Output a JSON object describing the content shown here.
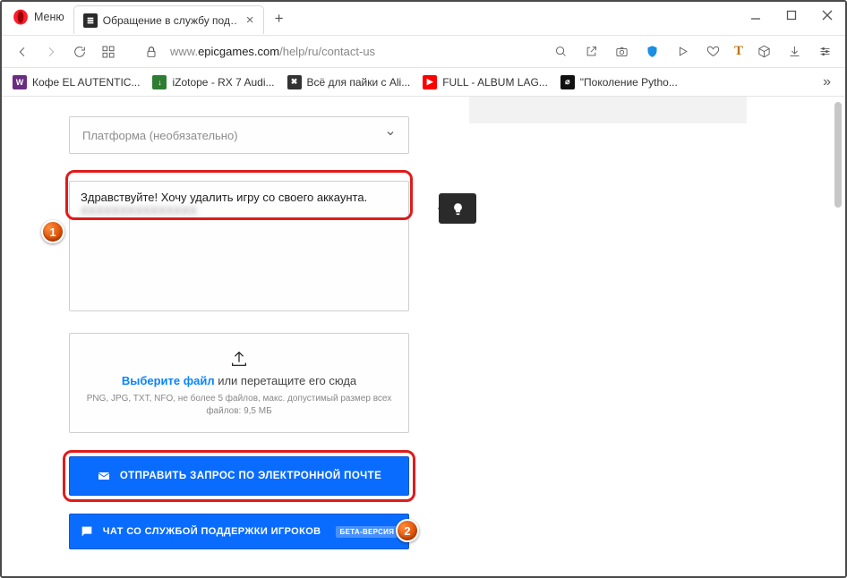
{
  "window": {
    "menu_label": "Меню",
    "tab_title": "Обращение в службу под…"
  },
  "address": {
    "url_prefix": "www.",
    "url_host": "epicgames.com",
    "url_path": "/help/ru/contact-us"
  },
  "bookmarks": [
    {
      "label": "Кофе EL AUTENTIC...",
      "bg": "#6a2d82",
      "glyph": "W"
    },
    {
      "label": "iZotope - RX 7 Audi...",
      "bg": "#2e7d32",
      "glyph": "↓"
    },
    {
      "label": "Всё для пайки с Ali...",
      "bg": "#333",
      "glyph": "✖"
    },
    {
      "label": "FULL - ALBUM LAG...",
      "bg": "#ff0000",
      "glyph": "▶"
    },
    {
      "label": "\"Поколение Pytho...",
      "bg": "#111",
      "glyph": "⌀"
    }
  ],
  "form": {
    "platform_placeholder": "Платформа (необязательно)",
    "textarea_value": "Здравствуйте! Хочу удалить игру со своего аккаунта.",
    "upload_link": "Выберите файл",
    "upload_rest": " или перетащите его сюда",
    "upload_hint": "PNG, JPG, TXT, NFO, не более 5 файлов, макс. допустимый размер всех файлов: 9,5 МБ",
    "email_button": "ОТПРАВИТЬ ЗАПРОС ПО ЭЛЕКТРОННОЙ ПОЧТЕ",
    "chat_button": "ЧАТ СО СЛУЖБОЙ ПОДДЕРЖКИ ИГРОКОВ",
    "chat_badge": "БЕТА-ВЕРСИЯ"
  },
  "callouts": {
    "one": "1",
    "two": "2"
  }
}
